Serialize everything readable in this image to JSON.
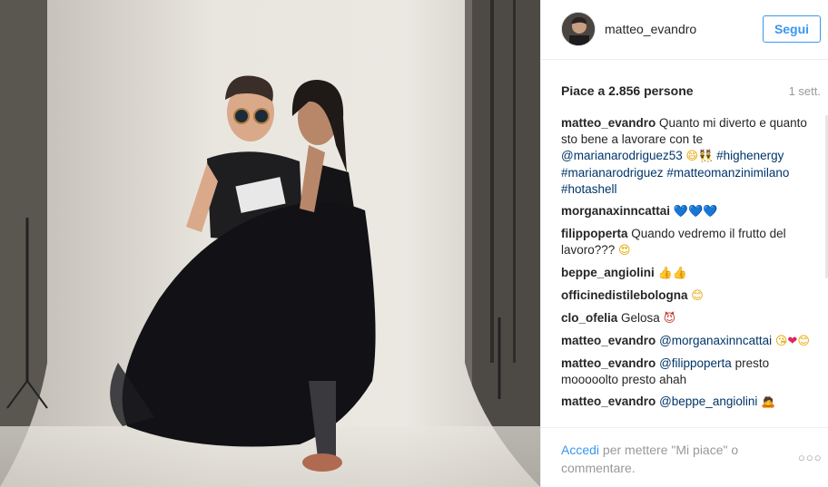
{
  "header": {
    "username": "matteo_evandro",
    "follow_label": "Segui"
  },
  "post": {
    "likes": "Piace a 2.856 persone",
    "time": "1 sett."
  },
  "comments": [
    {
      "user": "matteo_evandro",
      "parts": [
        {
          "t": "text",
          "v": " Quanto mi diverto e quanto sto bene a lavorare con te "
        },
        {
          "t": "mention",
          "v": "@marianarodriguez53"
        },
        {
          "t": "text",
          "v": " "
        },
        {
          "t": "emoji",
          "v": "😄",
          "c": "e-yellow"
        },
        {
          "t": "emoji",
          "v": "👯",
          "c": "e-yellow"
        },
        {
          "t": "text",
          "v": " "
        },
        {
          "t": "mention",
          "v": "#highenergy"
        },
        {
          "t": "text",
          "v": " "
        },
        {
          "t": "mention",
          "v": "#marianarodriguez"
        },
        {
          "t": "text",
          "v": " "
        },
        {
          "t": "mention",
          "v": "#matteomanzinimilano"
        },
        {
          "t": "text",
          "v": " "
        },
        {
          "t": "mention",
          "v": "#hotashell"
        }
      ]
    },
    {
      "user": "morganaxinncattai",
      "parts": [
        {
          "t": "text",
          "v": " "
        },
        {
          "t": "emoji",
          "v": "💙💙💙",
          "c": "e-heart-blue"
        }
      ]
    },
    {
      "user": "filippoperta",
      "parts": [
        {
          "t": "text",
          "v": " Quando vedremo il frutto del lavoro??? "
        },
        {
          "t": "emoji",
          "v": "😍",
          "c": "e-yellow"
        }
      ]
    },
    {
      "user": "beppe_angiolini",
      "parts": [
        {
          "t": "text",
          "v": " "
        },
        {
          "t": "emoji",
          "v": "👍👍",
          "c": "e-yellow"
        }
      ]
    },
    {
      "user": "officinedistilebologna",
      "parts": [
        {
          "t": "text",
          "v": " "
        },
        {
          "t": "emoji",
          "v": "😊",
          "c": "e-yellow"
        }
      ]
    },
    {
      "user": "clo_ofelia",
      "parts": [
        {
          "t": "text",
          "v": " Gelosa "
        },
        {
          "t": "emoji",
          "v": "😈",
          "c": "e-devil"
        }
      ]
    },
    {
      "user": "matteo_evandro",
      "parts": [
        {
          "t": "text",
          "v": " "
        },
        {
          "t": "mention",
          "v": "@morganaxinncattai"
        },
        {
          "t": "text",
          "v": " "
        },
        {
          "t": "emoji",
          "v": "😘",
          "c": "e-yellow"
        },
        {
          "t": "emoji",
          "v": "❤",
          "c": "e-heart-red"
        },
        {
          "t": "emoji",
          "v": "😊",
          "c": "e-yellow"
        }
      ]
    },
    {
      "user": "matteo_evandro",
      "parts": [
        {
          "t": "text",
          "v": " "
        },
        {
          "t": "mention",
          "v": "@filippoperta"
        },
        {
          "t": "text",
          "v": " presto mooooolto presto ahah"
        }
      ]
    },
    {
      "user": "matteo_evandro",
      "parts": [
        {
          "t": "text",
          "v": " "
        },
        {
          "t": "mention",
          "v": "@beppe_angiolini"
        },
        {
          "t": "text",
          "v": " "
        },
        {
          "t": "emoji",
          "v": "🙇",
          "c": "e-yellow"
        }
      ]
    }
  ],
  "footer": {
    "login_link": "Accedi",
    "login_rest": " per mettere \"Mi piace\" o commentare.",
    "more": "○○○"
  }
}
